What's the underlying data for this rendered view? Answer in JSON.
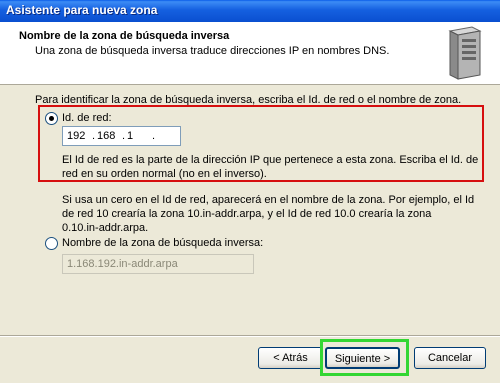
{
  "window": {
    "title": "Asistente para nueva zona"
  },
  "header": {
    "title": "Nombre de la zona de búsqueda inversa",
    "subtitle": "Una zona de búsqueda inversa traduce direcciones IP en nombres DNS.",
    "icon": "server-icon"
  },
  "main": {
    "instruction": "Para identificar la zona de búsqueda inversa, escriba el Id. de red o el nombre de zona.",
    "network_id": {
      "label": "Id. de red:",
      "selected": true,
      "octets": [
        "192",
        "168",
        "1",
        ""
      ],
      "help": "El Id de red es la parte de la dirección IP que pertenece a esta zona. Escriba el Id. de red en su orden normal (no en el inverso)."
    },
    "note_lines": [
      "Si usa un cero en el Id de red, aparecerá en el nombre de la zona.  Por ejemplo, el Id",
      "de red 10 crearía la zona 10.in-addr.arpa, y el Id de red 10.0 crearía la zona",
      "0.10.in-addr.arpa."
    ],
    "zone_name": {
      "label": "Nombre de la zona de búsqueda inversa:",
      "selected": false,
      "value": "1.168.192.in-addr.arpa"
    }
  },
  "buttons": {
    "back": "< Atrás",
    "next": "Siguiente >",
    "cancel": "Cancelar"
  },
  "colors": {
    "highlight_red": "#d60f0f",
    "highlight_green": "#33d633",
    "titlebar": "#0a5ce9"
  }
}
